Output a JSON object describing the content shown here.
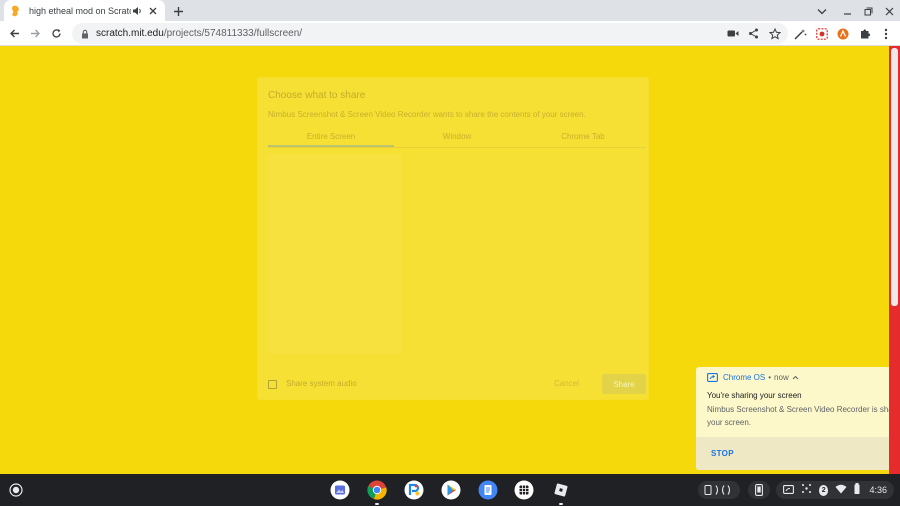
{
  "browser": {
    "tab": {
      "title": "high etheal mod on Scratch"
    },
    "address": {
      "host": "scratch.mit.edu",
      "path": "/projects/574811333/fullscreen/"
    }
  },
  "share_dialog": {
    "title": "Choose what to share",
    "subtitle": "Nimbus Screenshot & Screen Video Recorder wants to share the contents of your screen.",
    "tabs": [
      {
        "label": "Entire Screen"
      },
      {
        "label": "Window"
      },
      {
        "label": "Chrome Tab"
      }
    ],
    "checkbox_label": "Share system audio",
    "cancel_label": "Cancel",
    "share_label": "Share"
  },
  "notification": {
    "app": "Chrome OS",
    "separator": "•",
    "time": "now",
    "title": "You're sharing your screen",
    "body_line1": "Nimbus Screenshot & Screen Video Recorder is sharing",
    "body_line2": "your screen.",
    "action": "STOP"
  },
  "shelf": {
    "badge_count": "2",
    "clock": "4:36"
  },
  "colors": {
    "page_background": "#f5d90a",
    "scrollbar_track": "#e52b2b",
    "notification_accent": "#1a73e8"
  }
}
